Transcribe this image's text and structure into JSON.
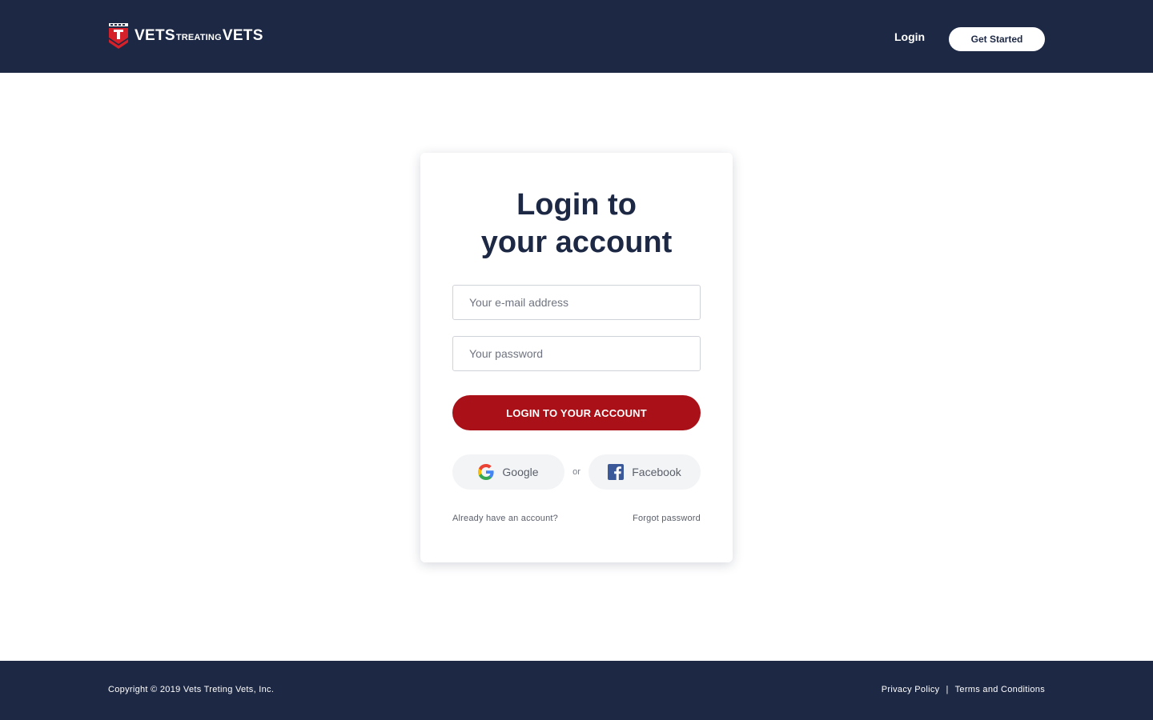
{
  "header": {
    "logo": {
      "part1": "VETS",
      "part2": "TREATING",
      "part3": "VETS"
    },
    "nav_login": "Login",
    "get_started": "Get Started"
  },
  "login_card": {
    "title_line1": "Login to",
    "title_line2": "your account",
    "email_placeholder": "Your e-mail address",
    "password_placeholder": "Your password",
    "submit_label": "LOGIN TO YOUR ACCOUNT",
    "google_label": "Google",
    "or_label": "or",
    "facebook_label": "Facebook",
    "account_link": "Already have an account?",
    "forgot_link": "Forgot password"
  },
  "footer": {
    "copyright": "Copyright © 2019 Vets Treting Vets, Inc.",
    "privacy": "Privacy Policy",
    "separator": "|",
    "terms": "Terms and Conditions"
  },
  "colors": {
    "navy": "#1d2844",
    "brand_red": "#a91018",
    "white": "#ffffff"
  }
}
